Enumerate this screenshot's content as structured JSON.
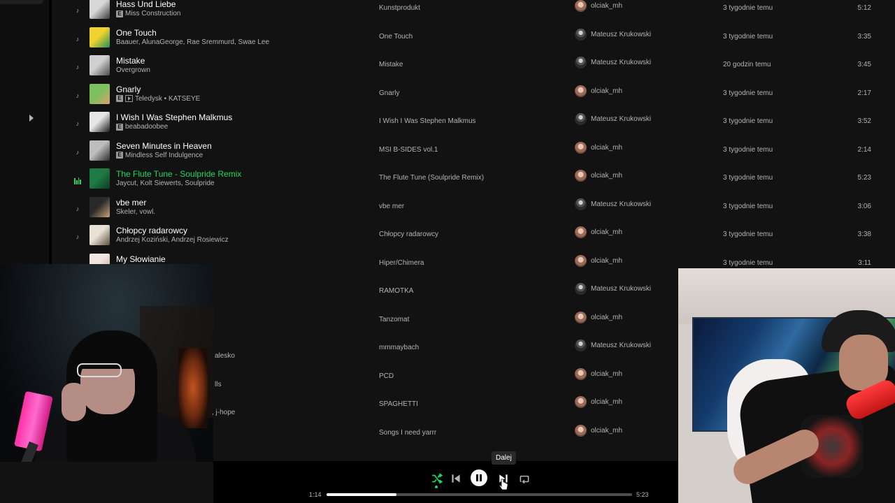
{
  "colors": {
    "accent": "#1ed760",
    "bg": "#121212",
    "text_primary": "#ffffff",
    "text_secondary": "#b3b3b3"
  },
  "tracks": [
    {
      "title": "Hass Und Liebe",
      "artists": "Miss Construction",
      "explicit": true,
      "video": false,
      "video_label": "",
      "album": "Kunstprodukt",
      "added_by": "olciak_mh",
      "added_by_avatar": "o",
      "date": "3 tygodnie temu",
      "duration": "5:12",
      "playing": false,
      "cover": [
        "#d8d8d8",
        "#3b3b3b"
      ]
    },
    {
      "title": "One Touch",
      "artists": "Baauer, AlunaGeorge, Rae Sremmurd, Swae Lee",
      "explicit": false,
      "video": false,
      "video_label": "",
      "album": "One Touch",
      "added_by": "Mateusz Krukowski",
      "added_by_avatar": "m",
      "date": "3 tygodnie temu",
      "duration": "3:35",
      "playing": false,
      "cover": [
        "#f2d22e",
        "#1f8f5a"
      ]
    },
    {
      "title": "Mistake",
      "artists": "Overgrown",
      "explicit": false,
      "video": false,
      "video_label": "",
      "album": "Mistake",
      "added_by": "Mateusz Krukowski",
      "added_by_avatar": "m",
      "date": "20 godzin temu",
      "duration": "3:45",
      "playing": false,
      "cover": [
        "#cfcfcf",
        "#4a4a4a"
      ]
    },
    {
      "title": "Gnarly",
      "artists": "Teledysk • KATSEYE",
      "explicit": true,
      "video": true,
      "video_label": "",
      "album": "Gnarly",
      "added_by": "olciak_mh",
      "added_by_avatar": "o",
      "date": "3 tygodnie temu",
      "duration": "2:17",
      "playing": false,
      "cover": [
        "#7bbf5e",
        "#d9a46b"
      ]
    },
    {
      "title": "I Wish I Was Stephen Malkmus",
      "artists": "beabadoobee",
      "explicit": true,
      "video": false,
      "video_label": "",
      "album": "I Wish I Was Stephen Malkmus",
      "added_by": "Mateusz Krukowski",
      "added_by_avatar": "m",
      "date": "3 tygodnie temu",
      "duration": "3:52",
      "playing": false,
      "cover": [
        "#e6e6e6",
        "#1c1c1c"
      ]
    },
    {
      "title": "Seven Minutes in Heaven",
      "artists": "Mindless Self Indulgence",
      "explicit": true,
      "video": false,
      "video_label": "",
      "album": "MSI B-SIDES vol.1",
      "added_by": "olciak_mh",
      "added_by_avatar": "o",
      "date": "3 tygodnie temu",
      "duration": "2:14",
      "playing": false,
      "cover": [
        "#bdbdbd",
        "#2b2b2b"
      ]
    },
    {
      "title": "The Flute Tune - Soulpride Remix",
      "artists": "Jaycut, Kolt Siewerts, Soulpride",
      "explicit": false,
      "video": false,
      "video_label": "",
      "album": "The Flute Tune (Soulpride Remix)",
      "added_by": "olciak_mh",
      "added_by_avatar": "o",
      "date": "3 tygodnie temu",
      "duration": "5:23",
      "playing": true,
      "cover": [
        "#1f7a43",
        "#0f3d22"
      ]
    },
    {
      "title": "vbe mer",
      "artists": "Skeler, vowl.",
      "explicit": false,
      "video": false,
      "video_label": "",
      "album": "vbe mer",
      "added_by": "Mateusz Krukowski",
      "added_by_avatar": "m",
      "date": "3 tygodnie temu",
      "duration": "3:06",
      "playing": false,
      "cover": [
        "#2a2a2a",
        "#c9a27a"
      ]
    },
    {
      "title": "Chłopcy radarowcy",
      "artists": "Andrzej Koziński, Andrzej Rosiewicz",
      "explicit": false,
      "video": false,
      "video_label": "",
      "album": "Chłopcy radarowcy",
      "added_by": "olciak_mh",
      "added_by_avatar": "o",
      "date": "3 tygodnie temu",
      "duration": "3:38",
      "playing": false,
      "cover": [
        "#e8e1d4",
        "#5c5040"
      ]
    },
    {
      "title": "My Słowianie",
      "artists": "",
      "explicit": false,
      "video": false,
      "video_label": "",
      "album": "Hiper/Chimera",
      "added_by": "olciak_mh",
      "added_by_avatar": "o",
      "date": "3 tygodnie temu",
      "duration": "3:11",
      "playing": false,
      "cover": [
        "#f1e6df",
        "#c2a79a"
      ]
    },
    {
      "title": "",
      "artists": "",
      "explicit": false,
      "video": false,
      "video_label": "",
      "album": "RAMOTKA",
      "added_by": "Mateusz Krukowski",
      "added_by_avatar": "m",
      "date": "",
      "duration": "",
      "playing": false,
      "cover": [
        "#333",
        "#222"
      ]
    },
    {
      "title": "",
      "artists": "",
      "explicit": false,
      "video": false,
      "video_label": "",
      "album": "Tanzomat",
      "added_by": "olciak_mh",
      "added_by_avatar": "o",
      "date": "",
      "duration": "",
      "playing": false,
      "cover": [
        "#333",
        "#222"
      ]
    },
    {
      "title": "",
      "artists": "",
      "explicit": false,
      "video": false,
      "video_label": "",
      "album": "mmmaybach",
      "added_by": "Mateusz Krukowski",
      "added_by_avatar": "m",
      "date": "",
      "duration": "",
      "playing": false,
      "cover": [
        "#333",
        "#222"
      ]
    },
    {
      "title": "",
      "artists": "",
      "explicit": false,
      "video": false,
      "video_label": "",
      "album": "PCD",
      "added_by": "olciak_mh",
      "added_by_avatar": "o",
      "date": "",
      "duration": "",
      "playing": false,
      "cover": [
        "#333",
        "#222"
      ]
    },
    {
      "title": "",
      "artists": "",
      "explicit": false,
      "video": false,
      "video_label": "",
      "album": "SPAGHETTI",
      "added_by": "olciak_mh",
      "added_by_avatar": "o",
      "date": "",
      "duration": "",
      "playing": false,
      "cover": [
        "#333",
        "#222"
      ]
    },
    {
      "title": "",
      "artists": "",
      "explicit": false,
      "video": false,
      "video_label": "",
      "album": "Songs I need yarrr",
      "added_by": "olciak_mh",
      "added_by_avatar": "o",
      "date": "",
      "duration": "",
      "playing": false,
      "cover": [
        "#333",
        "#222"
      ]
    }
  ],
  "partial_artists_behind_overlay": [
    "alesko",
    "lls",
    ", j-hope"
  ],
  "player": {
    "current_time": "1:14",
    "total_time": "5:23",
    "progress": 0.229,
    "shuffle_active": true,
    "is_playing": true,
    "tooltip": "Dalej",
    "icons": {
      "shuffle": "shuffle-icon",
      "prev": "skip-back-icon",
      "play": "pause-icon",
      "next": "skip-forward-icon",
      "repeat": "repeat-icon"
    }
  }
}
